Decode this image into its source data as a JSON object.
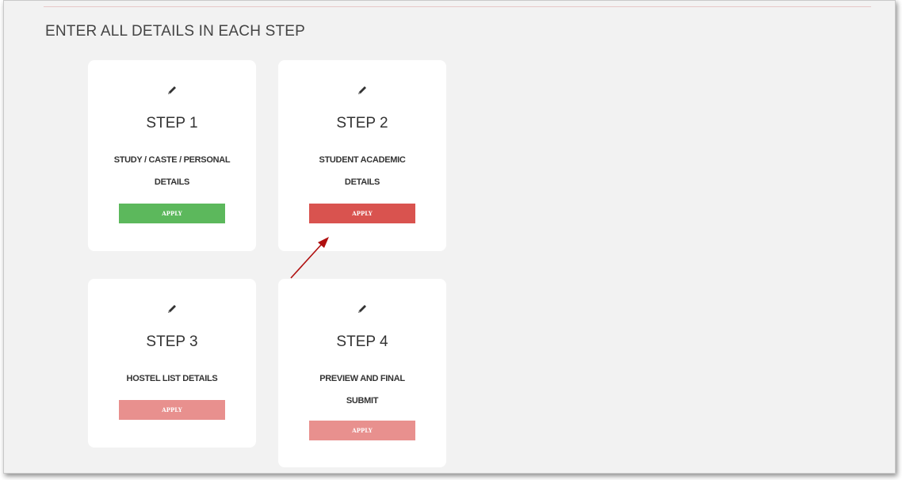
{
  "heading": "ENTER ALL DETAILS IN EACH STEP",
  "steps": [
    {
      "title": "STEP 1",
      "desc_line1": "STUDY / CASTE / PERSONAL",
      "desc_line2": "DETAILS",
      "button": "APPLY",
      "button_color": "#5cb85c"
    },
    {
      "title": "STEP 2",
      "desc_line1": "STUDENT ACADEMIC",
      "desc_line2": "DETAILS",
      "button": "APPLY",
      "button_color": "#d9534f"
    },
    {
      "title": "STEP 3",
      "desc_line1": "HOSTEL LIST DETAILS",
      "desc_line2": "",
      "button": "APPLY",
      "button_color": "#e8908e"
    },
    {
      "title": "STEP 4",
      "desc_line1": "PREVIEW AND FINAL",
      "desc_line2": "SUBMIT",
      "button": "APPLY",
      "button_color": "#e8908e"
    }
  ],
  "icons": {
    "step_icon": "pencil-icon",
    "annotation": "arrow-icon"
  },
  "colors": {
    "background": "#f2f2f2",
    "card": "#ffffff",
    "arrow": "#b01010"
  }
}
